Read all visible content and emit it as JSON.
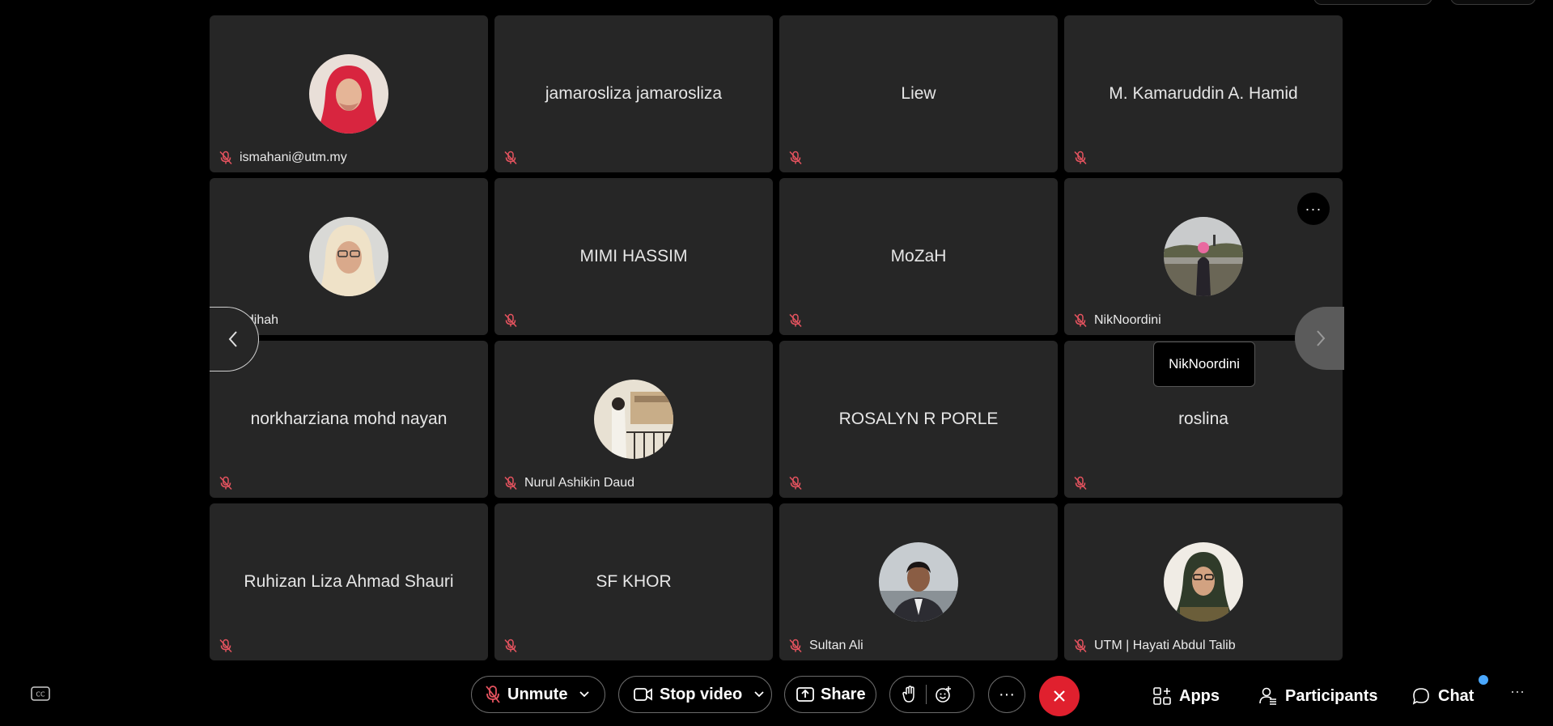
{
  "tiles": [
    {
      "name": "ismahani@utm.my",
      "avatar": "photo-hijab-red",
      "label_position": "footer"
    },
    {
      "name": "jamarosliza jamarosliza",
      "avatar": null,
      "label_position": "center"
    },
    {
      "name": "Liew",
      "avatar": null,
      "label_position": "center"
    },
    {
      "name": "M. Kamaruddin A. Hamid",
      "avatar": null,
      "label_position": "center"
    },
    {
      "name": "adihah",
      "avatar": "photo-hijab-cream",
      "label_position": "footer"
    },
    {
      "name": "MIMI HASSIM",
      "avatar": null,
      "label_position": "center"
    },
    {
      "name": "MoZaH",
      "avatar": null,
      "label_position": "center"
    },
    {
      "name": "NikNoordini",
      "avatar": "photo-outdoor",
      "label_position": "footer",
      "more_button": true
    },
    {
      "name": "norkharziana mohd nayan",
      "avatar": null,
      "label_position": "center"
    },
    {
      "name": "Nurul Ashikin Daud",
      "avatar": "photo-balcony",
      "label_position": "footer"
    },
    {
      "name": "ROSALYN R PORLE",
      "avatar": null,
      "label_position": "center"
    },
    {
      "name": "roslina",
      "avatar": null,
      "label_position": "center"
    },
    {
      "name": "Ruhizan Liza Ahmad Shauri",
      "avatar": null,
      "label_position": "center"
    },
    {
      "name": "SF KHOR",
      "avatar": null,
      "label_position": "center"
    },
    {
      "name": "Sultan Ali",
      "avatar": "photo-man",
      "label_position": "footer"
    },
    {
      "name": "UTM | Hayati Abdul Talib",
      "avatar": "photo-hijab-green",
      "label_position": "footer"
    }
  ],
  "tooltip": {
    "text": "NikNoordini"
  },
  "toolbar": {
    "unmute": "Unmute",
    "stop_video": "Stop video",
    "share": "Share",
    "more": "···",
    "apps": "Apps",
    "participants": "Participants",
    "chat": "Chat",
    "overflow": "···"
  },
  "tile_more": "···",
  "colors": {
    "mute_red": "#e6535f",
    "leave_red": "#e0202e",
    "tile_bg": "#262626",
    "chat_dot": "#4aa8ff"
  }
}
